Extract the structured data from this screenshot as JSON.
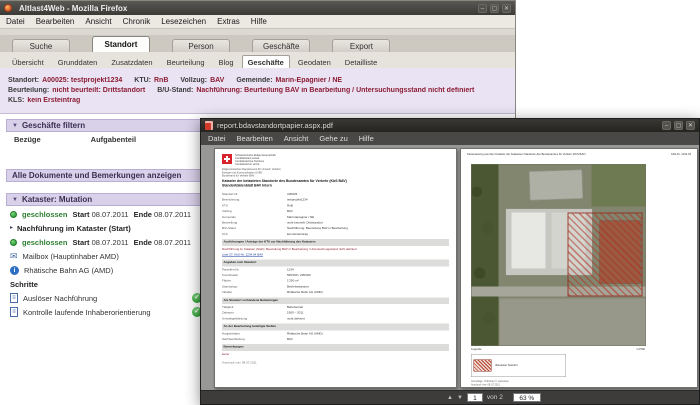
{
  "colors": {
    "accent_lavender": "#d9d1e9",
    "maroon_text": "#8c1d33",
    "status_green": "#2f9e38",
    "link_blue": "#15379e"
  },
  "window_firefox": {
    "title": "Altlast4Web - Mozilla Firefox",
    "menus": [
      "Datei",
      "Bearbeiten",
      "Ansicht",
      "Chronik",
      "Lesezeichen",
      "Extras",
      "Hilfe"
    ],
    "module_tabs": [
      {
        "label": "Suche"
      },
      {
        "label": "Standort",
        "cls": "active"
      },
      {
        "label": "Person"
      },
      {
        "label": "Geschäfte"
      },
      {
        "label": "Export"
      }
    ],
    "sub_tabs": [
      {
        "label": "Übersicht"
      },
      {
        "label": "Grunddaten"
      },
      {
        "label": "Zusatzdaten"
      },
      {
        "label": "Beurteilung"
      },
      {
        "label": "Blog"
      },
      {
        "label": "Geschäfte",
        "cls": "active"
      },
      {
        "label": "Geodaten"
      },
      {
        "label": "Detailliste"
      }
    ],
    "info": {
      "line1": [
        {
          "l": "Standort:",
          "v": "A00025: testprojekt1234"
        },
        {
          "l": "KTU:",
          "v": "RnB"
        },
        {
          "l": "Vollzug:",
          "v": "BAV"
        },
        {
          "l": "Gemeinde:",
          "v": "Marin-Epagnier / NE"
        }
      ],
      "line2": [
        {
          "l": "Beurteilung:",
          "v": "nicht beurteilt: Drittstandort"
        },
        {
          "l": "B/U-Stand:",
          "v": "Nachführung: Beurteilung BAV in Bearbeitung / Untersuchungsstand nicht definiert"
        }
      ],
      "line3": [
        {
          "l": "KLS:",
          "v": "kein Ersteintrag"
        }
      ]
    },
    "filter": {
      "title": "Geschäfte filtern",
      "fields": [
        {
          "label": "Bezüge"
        },
        {
          "label": "Aufgabenteil"
        }
      ]
    },
    "docs_bar": "Alle Dokumente und Bemerkungen anzeigen",
    "kataster": {
      "title": "Kataster: Mutation",
      "row1": {
        "status": "geschlossen",
        "start_label": "Start",
        "start_date": "08.07.2011",
        "end_label": "Ende",
        "end_date": "08.07.2011"
      },
      "subsection": "Nachführung im Kataster (Start)",
      "row2": {
        "status": "geschlossen",
        "start_label": "Start",
        "start_date": "08.07.2011",
        "end_label": "Ende",
        "end_date": "08.07.2011"
      },
      "mailbox": "Mailbox (Hauptinhaber AMD)",
      "holder": "Rhätische Bahn AG (AMD)",
      "steps_label": "Schritte",
      "steps": [
        {
          "label": "Auslöser Nachführung"
        },
        {
          "label": "Kontrolle laufende Inhaberorientierung"
        }
      ]
    }
  },
  "window_pdf": {
    "title": "report.bdavstandortpapier.aspx.pdf",
    "menus": [
      "Datei",
      "Bearbeiten",
      "Ansicht",
      "Gehe zu",
      "Hilfe"
    ],
    "statusbar": {
      "page_value": "1",
      "page_of": "von 2",
      "zoom_value": "63 %"
    },
    "page1": {
      "confed_lines": [
        "Schweizerische Eidgenossenschaft",
        "Confédération suisse",
        "Confederazione Svizzera",
        "Confederaziun svizra"
      ],
      "dept_lines": [
        "Eidgenössisches Departement für Umwelt, Verkehr,",
        "Energie und Kommunikation UVEK",
        "Bundesamt für Verkehr BAV"
      ],
      "title_line1": "Kataster der belasteten Standorte des Bundesamtes für Verkehr (KbS BAV)",
      "title_line2": "Standortdatenblatt BAV Intern",
      "rows": [
        {
          "t": "kv",
          "l": "Standort-Nr.",
          "v": "A00025"
        },
        {
          "t": "kv",
          "l": "Bezeichnung",
          "v": "testprojekt1234"
        },
        {
          "t": "kv",
          "l": "KTU",
          "v": "RnB"
        },
        {
          "t": "kv",
          "l": "Vollzug",
          "v": "BAV"
        },
        {
          "t": "kv",
          "l": "Gemeinde",
          "v": "Marin-Epagnier / NE"
        },
        {
          "t": "kv",
          "l": "Beurteilung",
          "v": "nicht beurteilt: Drittstandort"
        },
        {
          "t": "kv",
          "l": "B/U-Stand",
          "v": "Nachführung: Beurteilung BAV in Bearbeitung"
        },
        {
          "t": "kv",
          "l": "KLS",
          "v": "kein Ersteintrag"
        },
        {
          "t": "sec",
          "l": "Ausführungen / Anträge der KTU zur Nachführung des Katasters"
        },
        {
          "t": "para",
          "l": "Nachführung im Kataster (Start): Beurteilung BAV in Bearbeitung / Untersuchungsstand nicht definiert"
        },
        {
          "t": "link",
          "l": "Liste 27: KbS-Nr. 1234.04 BAV"
        },
        {
          "t": "sec",
          "l": "Angaben zum Standort"
        },
        {
          "t": "kv",
          "l": "Parzellen-Nr.",
          "v": "1234"
        },
        {
          "t": "kv",
          "l": "Koordinaten",
          "v": "565'000 / 205'000"
        },
        {
          "t": "kv",
          "l": "Fläche",
          "v": "1'250 m²"
        },
        {
          "t": "kv",
          "l": "Standorttyp",
          "v": "Betriebsstandort"
        },
        {
          "t": "kv",
          "l": "Inhaber",
          "v": "Rhätische Bahn AG (AMD)"
        },
        {
          "t": "sec",
          "l": "Am Standort vorhandene Belastungen"
        },
        {
          "t": "kv",
          "l": "Tätigkeit",
          "v": "Bahnbetrieb"
        },
        {
          "t": "kv",
          "l": "Zeitraum",
          "v": "1900 – 2011"
        },
        {
          "t": "kv",
          "l": "Umweltgefährdung",
          "v": "nicht definiert"
        },
        {
          "t": "sec",
          "l": "An der Bearbeitung beteiligte Stellen"
        },
        {
          "t": "kv",
          "l": "Hauptinhaber",
          "v": "Rhätische Bahn AG (AMD)"
        },
        {
          "t": "kv",
          "l": "Sachbearbeitung",
          "v": "BAV"
        },
        {
          "t": "sec",
          "l": "Bemerkungen"
        },
        {
          "t": "para",
          "l": "keine"
        },
        {
          "t": "foot",
          "l": "Ausdruck vom 08.07.2011"
        }
      ]
    },
    "page2": {
      "header_left": "Kartenauszug aus dem Kataster der belasteten Standorte des Bundesamtes für Verkehr (KbS BAV)",
      "header_right": "KbS-Nr. 1234.04",
      "legend_title": "Legende",
      "scale_label": "1:2'500",
      "legend_item": "Belasteter Standort",
      "footnotes": [
        "Grundlage: Orthofoto © swisstopo",
        "Ausdruck vom 08.07.2011"
      ]
    }
  }
}
